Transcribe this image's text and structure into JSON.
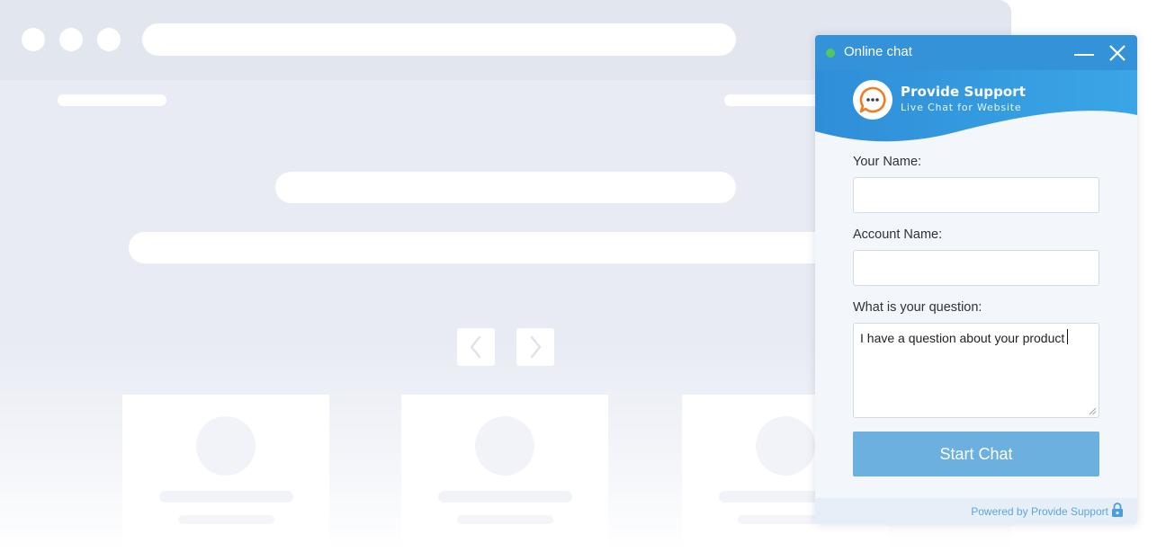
{
  "window": {
    "title": "Online chat",
    "status": "online",
    "status_color": "#56c760",
    "header_color": "#3493d8"
  },
  "brand": {
    "name": "Provide Support",
    "tagline": "Live Chat for Website",
    "logo_icon": "chat-bubble-icon",
    "accent": "#f07d22"
  },
  "form": {
    "name_label": "Your Name:",
    "name_value": "",
    "account_label": "Account Name:",
    "account_value": "",
    "question_label": "What is your question:",
    "question_value": "I have a question about your product",
    "submit_label": "Start Chat",
    "submit_color": "#6bb0df"
  },
  "footer": {
    "powered_by": "Powered by Provide Support",
    "icon": "lock-icon"
  },
  "background_page": {
    "nav_prev_icon": "chevron-left-icon",
    "nav_next_icon": "chevron-right-icon",
    "window_controls": [
      "circle-icon",
      "circle-icon",
      "circle-icon"
    ]
  }
}
